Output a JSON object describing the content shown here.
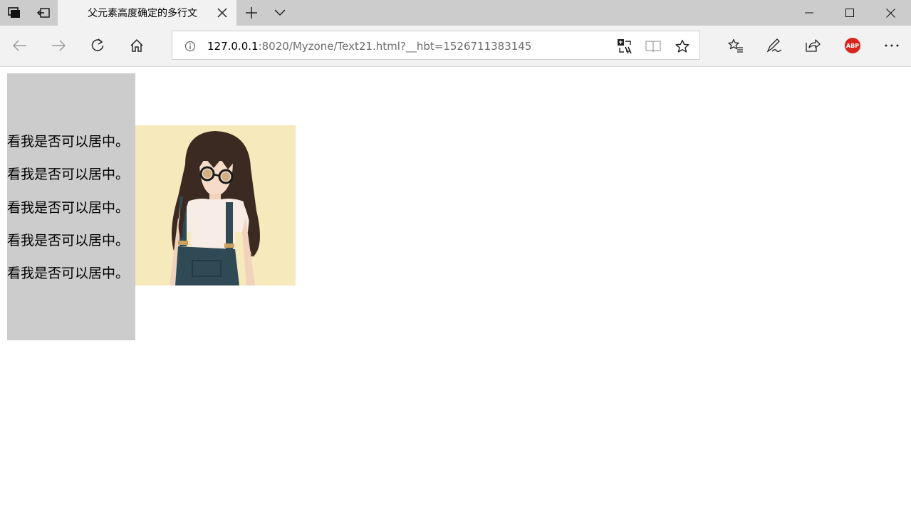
{
  "tab": {
    "title": "父元素高度确定的多行文"
  },
  "address_bar": {
    "host": "127.0.0.1",
    "path": ":8020/Myzone/Text21.html?__hbt=1526711383145"
  },
  "toolbar": {
    "adblock_label": "ABP"
  },
  "page": {
    "lines": [
      "看我是否可以居中。",
      "看我是否可以居中。",
      "看我是否可以居中。",
      "看我是否可以居中。",
      "看我是否可以居中。"
    ],
    "box_color": "#cccccc",
    "image_background": "#f6e9bb"
  }
}
